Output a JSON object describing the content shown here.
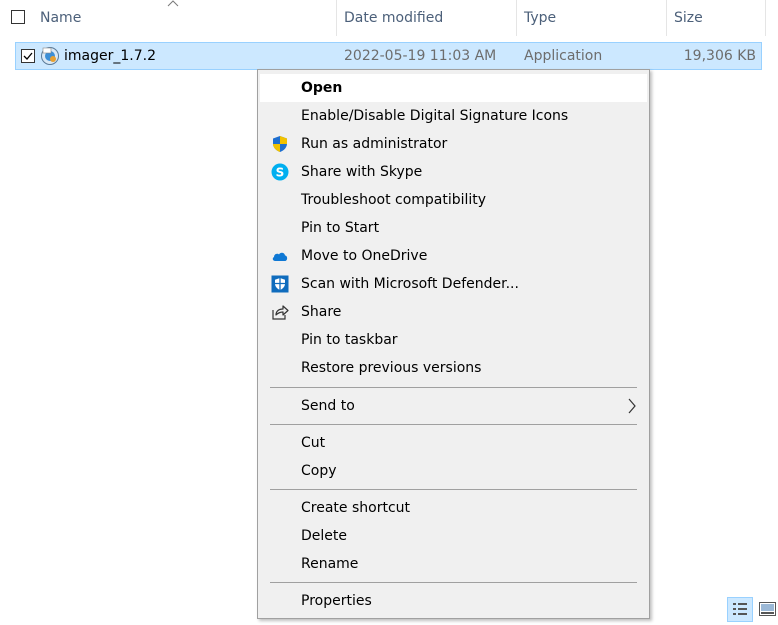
{
  "columns": {
    "name": "Name",
    "date_modified": "Date modified",
    "type": "Type",
    "size": "Size"
  },
  "file": {
    "name": "imager_1.7.2",
    "date_modified": "2022-05-19 11:03 AM",
    "type": "Application",
    "size": "19,306 KB",
    "selected": true
  },
  "menu": {
    "items": [
      {
        "label": "Open",
        "icon": null,
        "bold": true
      },
      {
        "label": "Enable/Disable Digital Signature Icons",
        "icon": null
      },
      {
        "label": "Run as administrator",
        "icon": "uac-shield-icon"
      },
      {
        "label": "Share with Skype",
        "icon": "skype-icon"
      },
      {
        "label": "Troubleshoot compatibility",
        "icon": null
      },
      {
        "label": "Pin to Start",
        "icon": null
      },
      {
        "label": "Move to OneDrive",
        "icon": "onedrive-icon"
      },
      {
        "label": "Scan with Microsoft Defender...",
        "icon": "defender-icon"
      },
      {
        "label": "Share",
        "icon": "share-icon"
      },
      {
        "label": "Pin to taskbar",
        "icon": null
      },
      {
        "label": "Restore previous versions",
        "icon": null
      },
      {
        "label": "Send to",
        "icon": null,
        "submenu": true
      },
      {
        "label": "Cut",
        "icon": null
      },
      {
        "label": "Copy",
        "icon": null
      },
      {
        "label": "Create shortcut",
        "icon": null
      },
      {
        "label": "Delete",
        "icon": null
      },
      {
        "label": "Rename",
        "icon": null
      },
      {
        "label": "Properties",
        "icon": null
      }
    ]
  },
  "colors": {
    "selection_bg": "#cce8ff",
    "selection_border": "#99d1ff",
    "menu_bg": "#f0f0f0",
    "header_text": "#4c607a",
    "shield_blue": "#1e6fd0",
    "shield_yellow": "#f2c200",
    "skype_blue": "#00aff0",
    "onedrive_blue": "#0f78d4",
    "defender_blue": "#0f6cbd"
  }
}
